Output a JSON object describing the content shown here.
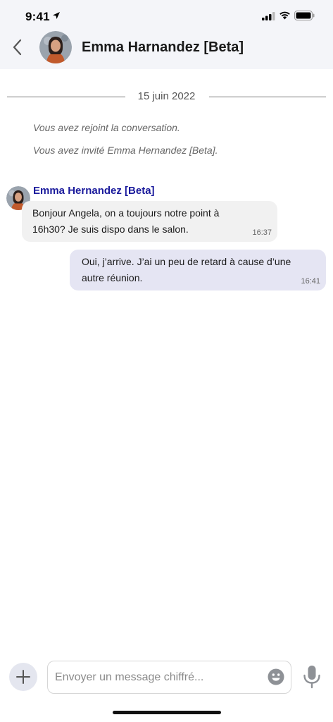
{
  "status_bar": {
    "time": "9:41"
  },
  "header": {
    "title": "Emma Harnandez [Beta]"
  },
  "conversation": {
    "date_separator": "15 juin 2022",
    "system_messages": [
      "Vous avez rejoint la conversation.",
      "Vous avez invité Emma Hernandez [Beta]."
    ],
    "messages": [
      {
        "sender": "Emma Hernandez [Beta]",
        "lines": [
          "Bonjour Angela, on a toujours notre point à",
          "16h30? Je suis dispo dans le salon."
        ],
        "time": "16:37"
      },
      {
        "lines": [
          "Oui, j’arrive. J’ai un peu de retard à cause d’une",
          "autre réunion."
        ],
        "time": "16:41"
      }
    ]
  },
  "composer": {
    "placeholder": "Envoyer un message chiffré..."
  },
  "colors": {
    "header_bg": "#f4f5f9",
    "sender_name": "#1a1a9c",
    "incoming_bubble": "#f1f1f1",
    "outgoing_bubble": "#e5e5f3"
  },
  "icons": [
    "location-arrow-icon",
    "signal-icon",
    "wifi-icon",
    "battery-icon",
    "back-chevron-icon",
    "plus-icon",
    "emoji-icon",
    "microphone-icon"
  ]
}
